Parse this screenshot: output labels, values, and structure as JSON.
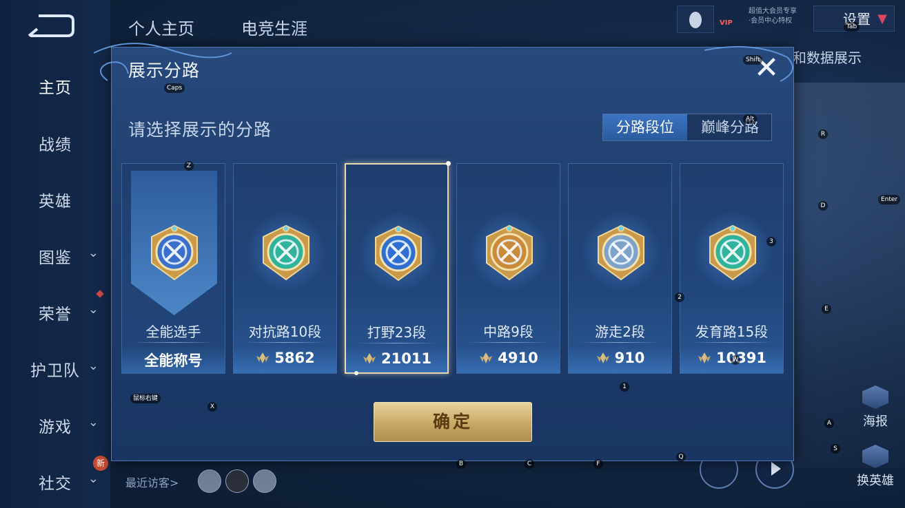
{
  "sidebar": {
    "items": [
      {
        "label": "主页",
        "has_chevron": false
      },
      {
        "label": "战绩",
        "has_chevron": false
      },
      {
        "label": "英雄",
        "has_chevron": false
      },
      {
        "label": "图鉴",
        "has_chevron": true
      },
      {
        "label": "荣誉",
        "has_chevron": true
      },
      {
        "label": "护卫队",
        "has_chevron": true
      },
      {
        "label": "游戏",
        "has_chevron": true
      },
      {
        "label": "社交",
        "has_chevron": true
      }
    ],
    "new_badge": "新"
  },
  "header": {
    "tabs": [
      "个人主页",
      "电竞生涯"
    ],
    "vip_label": "VIP",
    "vip_lines": [
      "超值大会员专享",
      "·会员中心特权"
    ],
    "settings_label": "设置"
  },
  "background": {
    "data_show_label": "和数据展示",
    "visitor_label": "最近访客>",
    "right_buttons": [
      "海报",
      "换英雄"
    ]
  },
  "dialog": {
    "title": "展示分路",
    "close_label": "✕",
    "subtitle": "请选择展示的分路",
    "segments": [
      {
        "label": "分路段位",
        "active": true
      },
      {
        "label": "巅峰分路",
        "active": false
      }
    ],
    "cards": [
      {
        "lane": "全能选手",
        "score": "全能称号",
        "emblem": "all-round-emblem",
        "accent": "#3b6fcc",
        "show_points_icon": false,
        "selected": false
      },
      {
        "lane": "对抗路10段",
        "score": "5862",
        "emblem": "clash-lane-emblem",
        "accent": "#2fb39a",
        "show_points_icon": true,
        "selected": false
      },
      {
        "lane": "打野23段",
        "score": "21011",
        "emblem": "jungle-emblem",
        "accent": "#2f6fd0",
        "show_points_icon": true,
        "selected": true
      },
      {
        "lane": "中路9段",
        "score": "4910",
        "emblem": "mid-lane-emblem",
        "accent": "#c98a3a",
        "show_points_icon": true,
        "selected": false
      },
      {
        "lane": "游走2段",
        "score": "910",
        "emblem": "roam-emblem",
        "accent": "#7fa2c8",
        "show_points_icon": true,
        "selected": false
      },
      {
        "lane": "发育路15段",
        "score": "10391",
        "emblem": "farm-lane-emblem",
        "accent": "#2fb39a",
        "show_points_icon": true,
        "selected": false
      }
    ],
    "confirm_label": "确定"
  },
  "key_hints": [
    "Tab",
    "Shift",
    "Caps",
    "Alt",
    "R",
    "Z",
    "D",
    "Enter",
    "3",
    "2",
    "E",
    "W",
    "1",
    "鼠标右键",
    "X",
    "A",
    "S",
    "B",
    "C",
    "F",
    "Q"
  ],
  "colors": {
    "dialog_bg": "#1f3e6e",
    "gold": "#d9bd7f",
    "selected_border": "#e8d9b0"
  }
}
